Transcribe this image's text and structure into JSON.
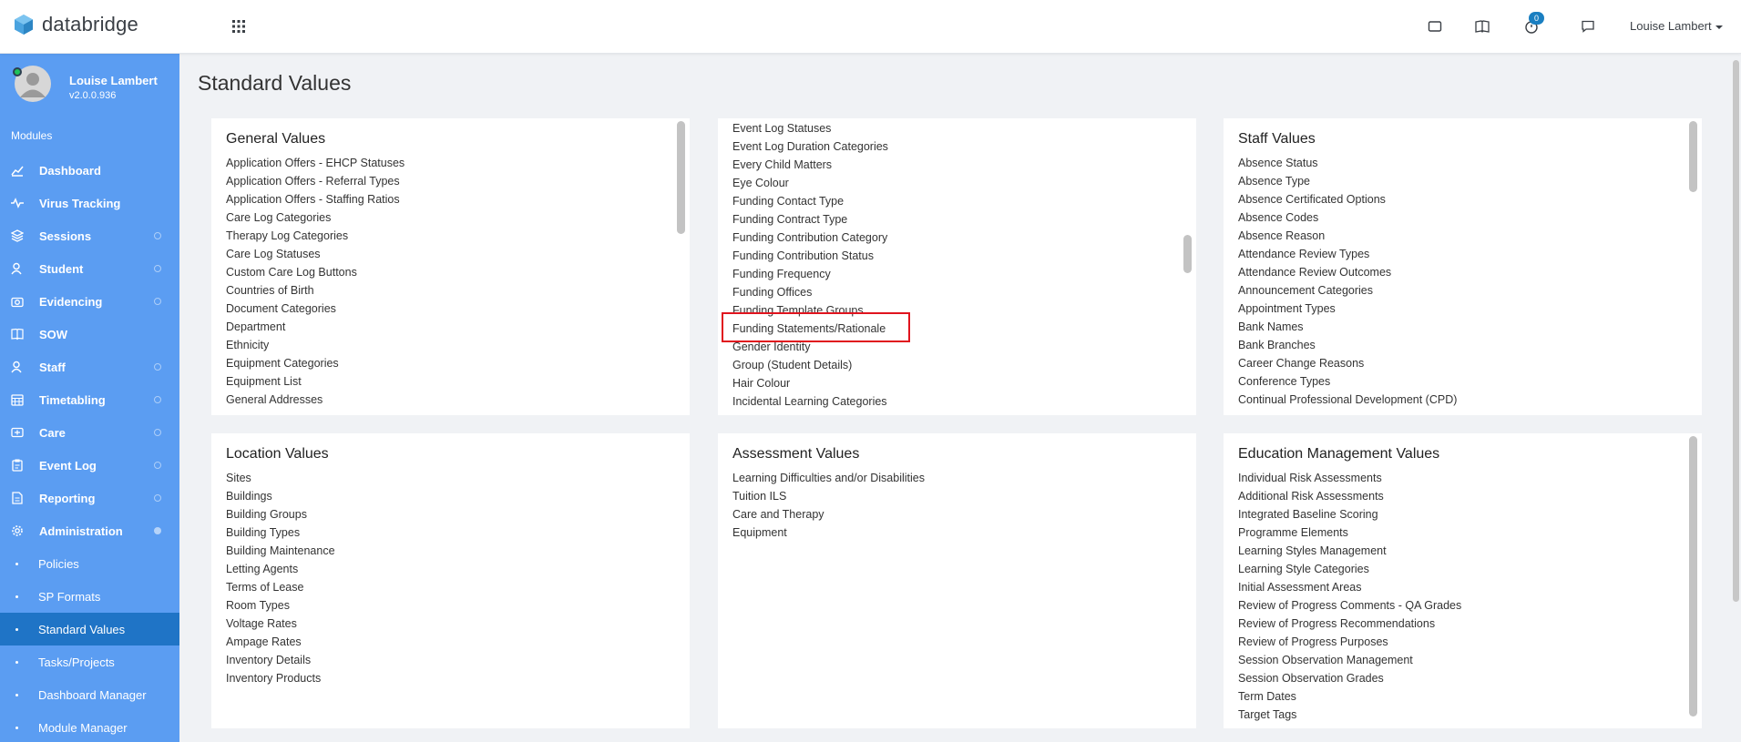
{
  "app": {
    "brand": "databridge",
    "accent": "#5b9df2",
    "active_nav": "#1f74c6"
  },
  "topbar": {
    "icons": [
      "apps-grid-icon",
      "tablet-icon",
      "book-icon",
      "timer-icon",
      "chat-icon"
    ],
    "timer_badge": "0",
    "user_name": "Louise Lambert"
  },
  "sidebar": {
    "profile_name": "Louise Lambert",
    "version": "v2.0.0.936",
    "modules_label": "Modules",
    "items": [
      {
        "label": "Dashboard",
        "icon": "chart-line-icon"
      },
      {
        "label": "Virus Tracking",
        "icon": "pulse-icon"
      },
      {
        "label": "Sessions",
        "icon": "layers-icon"
      },
      {
        "label": "Student",
        "icon": "user-icon"
      },
      {
        "label": "Evidencing",
        "icon": "camera-icon"
      },
      {
        "label": "SOW",
        "icon": "book-icon"
      },
      {
        "label": "Staff",
        "icon": "user-icon"
      },
      {
        "label": "Timetabling",
        "icon": "calendar-icon"
      },
      {
        "label": "Care",
        "icon": "care-icon"
      },
      {
        "label": "Event Log",
        "icon": "clipboard-icon"
      },
      {
        "label": "Reporting",
        "icon": "report-icon"
      },
      {
        "label": "Administration",
        "icon": "gear-icon"
      }
    ],
    "sub_items": [
      {
        "label": "Policies"
      },
      {
        "label": "SP Formats"
      },
      {
        "label": "Standard Values"
      },
      {
        "label": "Tasks/Projects"
      },
      {
        "label": "Dashboard Manager"
      },
      {
        "label": "Module Manager"
      }
    ]
  },
  "page": {
    "title": "Standard Values",
    "panels": {
      "general": {
        "title": "General Values",
        "items": [
          "Application Offers - EHCP Statuses",
          "Application Offers - Referral Types",
          "Application Offers - Staffing Ratios",
          "Care Log Categories",
          "Therapy Log Categories",
          "Care Log Statuses",
          "Custom Care Log Buttons",
          "Countries of Birth",
          "Document Categories",
          "Department",
          "Ethnicity",
          "Equipment Categories",
          "Equipment List",
          "General Addresses"
        ]
      },
      "general_scrolled": {
        "items": [
          "Event Log Statuses",
          "Event Log Duration Categories",
          "Every Child Matters",
          "Eye Colour",
          "Funding Contact Type",
          "Funding Contract Type",
          "Funding Contribution Category",
          "Funding Contribution Status",
          "Funding Frequency",
          "Funding Offices",
          "Funding Template Groups",
          "Funding Statements/Rationale",
          "Gender Identity",
          "Group (Student Details)",
          "Hair Colour",
          "Incidental Learning Categories"
        ]
      },
      "staff": {
        "title": "Staff Values",
        "items": [
          "Absence Status",
          "Absence Type",
          "Absence Certificated Options",
          "Absence Codes",
          "Absence Reason",
          "Attendance Review Types",
          "Attendance Review Outcomes",
          "Announcement Categories",
          "Appointment Types",
          "Bank Names",
          "Bank Branches",
          "Career Change Reasons",
          "Conference Types",
          "Continual Professional Development (CPD)"
        ]
      },
      "location": {
        "title": "Location Values",
        "items": [
          "Sites",
          "Buildings",
          "Building Groups",
          "Building Types",
          "Building Maintenance",
          "Letting Agents",
          "Terms of Lease",
          "Room Types",
          "Voltage Rates",
          "Ampage Rates",
          "Inventory Details",
          "Inventory Products"
        ]
      },
      "assessment": {
        "title": "Assessment Values",
        "items": [
          "Learning Difficulties and/or Disabilities",
          "Tuition ILS",
          "Care and Therapy",
          "Equipment"
        ]
      },
      "education": {
        "title": "Education Management Values",
        "items": [
          "Individual Risk Assessments",
          "Additional Risk Assessments",
          "Integrated Baseline Scoring",
          "Programme Elements",
          "Learning Styles Management",
          "Learning Style Categories",
          "Initial Assessment Areas",
          "Review of Progress Comments - QA Grades",
          "Review of Progress Recommendations",
          "Review of Progress Purposes",
          "Session Observation Management",
          "Session Observation Grades",
          "Term Dates",
          "Target Tags"
        ]
      }
    },
    "highlighted_item": "Funding Statements/Rationale",
    "highlight_color": "#e0141e"
  }
}
